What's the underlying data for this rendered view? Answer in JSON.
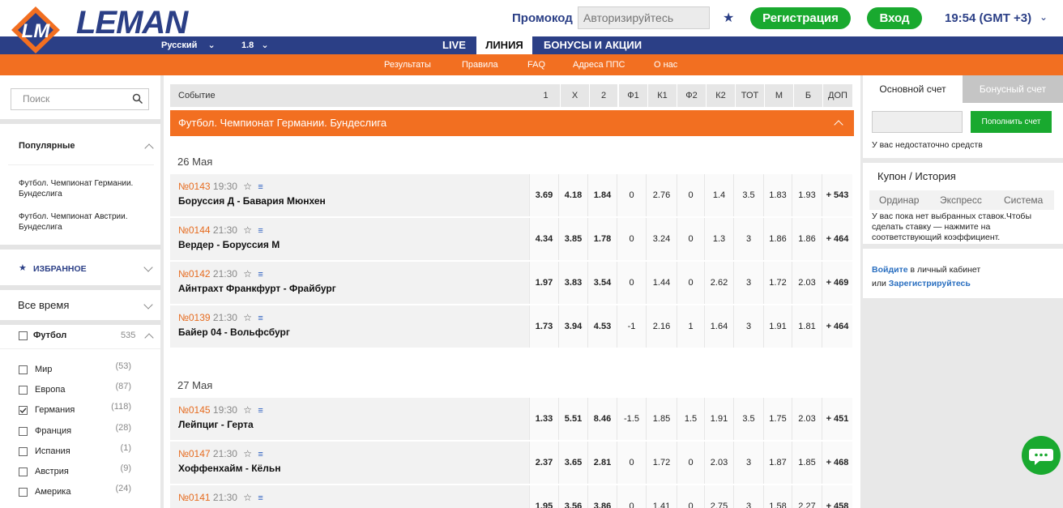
{
  "header": {
    "logo_text": "LEMAN",
    "promo_label": "Промокод",
    "promo_placeholder": "Авторизируйтесь",
    "register": "Регистрация",
    "login": "Вход",
    "clock": "19:54 (GMT +3)"
  },
  "nav": {
    "language": "Русский",
    "odds_format": "1.8",
    "items": [
      "LIVE",
      "ЛИНИЯ",
      "БОНУСЫ И АКЦИИ"
    ]
  },
  "subnav": [
    "Результаты",
    "Правила",
    "FAQ",
    "Адреса ППС",
    "О нас"
  ],
  "sidebar": {
    "search_placeholder": "Поиск",
    "popular_title": "Популярные",
    "popular": [
      "Футбол. Чемпионат Германии. Бундеслига",
      "Футбол. Чемпионат Австрии. Бундеслига"
    ],
    "favorites": "ИЗБРАННОЕ",
    "period": "Все время",
    "sport": {
      "label": "Футбол",
      "count": "535"
    },
    "countries": [
      {
        "label": "Мир",
        "count": "(53)",
        "checked": false
      },
      {
        "label": "Европа",
        "count": "(87)",
        "checked": false
      },
      {
        "label": "Германия",
        "count": "(118)",
        "checked": true
      },
      {
        "label": "Франция",
        "count": "(28)",
        "checked": false
      },
      {
        "label": "Испания",
        "count": "(1)",
        "checked": false
      },
      {
        "label": "Австрия",
        "count": "(9)",
        "checked": false
      },
      {
        "label": "Америка",
        "count": "(24)",
        "checked": false
      }
    ]
  },
  "table": {
    "headers": [
      "Событие",
      "1",
      "X",
      "2",
      "Ф1",
      "К1",
      "Ф2",
      "К2",
      "ТОТ",
      "М",
      "Б",
      "ДОП"
    ],
    "league": "Футбол. Чемпионат Германии. Бундеслига",
    "dates": [
      "26 Мая",
      "27 Мая"
    ],
    "rows": [
      {
        "num": "№0143",
        "time": "19:30",
        "teams": "Боруссия Д - Бавария Мюнхен",
        "odds": [
          "3.69",
          "4.18",
          "1.84",
          "0",
          "2.76",
          "0",
          "1.4",
          "3.5",
          "1.83",
          "1.93",
          "+ 543"
        ]
      },
      {
        "num": "№0144",
        "time": "21:30",
        "teams": "Вердер - Боруссия М",
        "odds": [
          "4.34",
          "3.85",
          "1.78",
          "0",
          "3.24",
          "0",
          "1.3",
          "3",
          "1.86",
          "1.86",
          "+ 464"
        ]
      },
      {
        "num": "№0142",
        "time": "21:30",
        "teams": "Айнтрахт Франкфурт - Фрайбург",
        "odds": [
          "1.97",
          "3.83",
          "3.54",
          "0",
          "1.44",
          "0",
          "2.62",
          "3",
          "1.72",
          "2.03",
          "+ 469"
        ]
      },
      {
        "num": "№0139",
        "time": "21:30",
        "teams": "Байер 04 - Вольфсбург",
        "odds": [
          "1.73",
          "3.94",
          "4.53",
          "-1",
          "2.16",
          "1",
          "1.64",
          "3",
          "1.91",
          "1.81",
          "+ 464"
        ]
      },
      {
        "num": "№0145",
        "time": "19:30",
        "teams": "Лейпциг - Герта",
        "odds": [
          "1.33",
          "5.51",
          "8.46",
          "-1.5",
          "1.85",
          "1.5",
          "1.91",
          "3.5",
          "1.75",
          "2.03",
          "+ 451"
        ]
      },
      {
        "num": "№0147",
        "time": "21:30",
        "teams": "Хоффенхайм - Кёльн",
        "odds": [
          "2.37",
          "3.65",
          "2.81",
          "0",
          "1.72",
          "0",
          "2.03",
          "3",
          "1.87",
          "1.85",
          "+ 468"
        ]
      },
      {
        "num": "№0141",
        "time": "21:30",
        "teams": "",
        "odds": [
          "1.95",
          "3.56",
          "3.86",
          "0",
          "1.41",
          "0",
          "2.75",
          "3",
          "1.58",
          "2.27",
          "+ 458"
        ]
      }
    ]
  },
  "right": {
    "tab_main": "Основной счет",
    "tab_bonus": "Бонусный счет",
    "deposit": "Пополнить счет",
    "no_funds": "У вас недостаточно средств",
    "coupon_title": "Купон / История",
    "coupon_tabs": [
      "Ординар",
      "Экспресс",
      "Система"
    ],
    "coupon_hint": "У вас пока нет выбранных ставок.Чтобы сделать ставку — нажмите на соответствующий коэффициент.",
    "login_link": "Войдите",
    "login_text": " в личный кабинет",
    "or_text": "или ",
    "register_link": "Зарегистрируйтесь"
  },
  "colors": {
    "brand": "#2b3f86",
    "accent": "#f26f21",
    "green": "#19a92f"
  }
}
